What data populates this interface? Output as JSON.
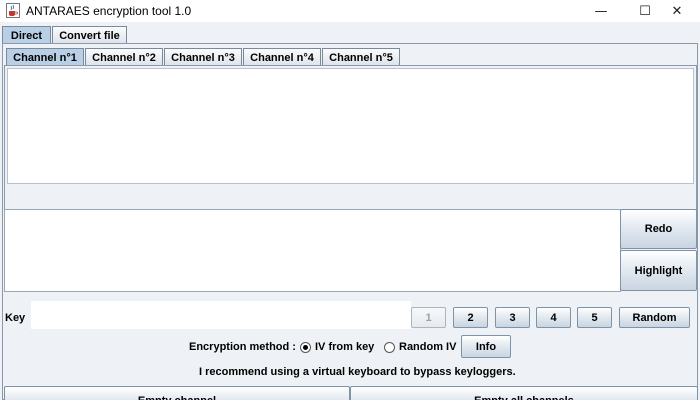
{
  "window": {
    "title": "ANTARAES encryption tool 1.0",
    "app_icon": "java-cup-icon",
    "controls": {
      "minimize": "—",
      "maximize": "☐",
      "close": "✕"
    }
  },
  "main_tabs": [
    {
      "label": "Direct",
      "active": true
    },
    {
      "label": "Convert file",
      "active": false
    }
  ],
  "channel_tabs": [
    {
      "label": "Channel n°1",
      "active": true
    },
    {
      "label": "Channel n°2",
      "active": false
    },
    {
      "label": "Channel n°3",
      "active": false
    },
    {
      "label": "Channel n°4",
      "active": false
    },
    {
      "label": "Channel n°5",
      "active": false
    }
  ],
  "output_text": "",
  "input_text": "",
  "side_buttons": {
    "redo": "Redo",
    "highlight": "Highlight"
  },
  "key": {
    "label": "Key",
    "value": "",
    "number_buttons": [
      "1",
      "2",
      "3",
      "4",
      "5"
    ],
    "selected_number": "1",
    "random": "Random"
  },
  "encryption": {
    "label": "Encryption method :",
    "options": [
      {
        "label": "IV from key",
        "checked": true
      },
      {
        "label": "Random IV",
        "checked": false
      }
    ],
    "info": "Info"
  },
  "note": "I recommend using a virtual keyboard to bypass keyloggers.",
  "bottom_buttons": {
    "empty_channel": "Empty channel",
    "empty_all": "Empty all channels"
  },
  "colors": {
    "background": "#eef2f6",
    "active_tab": "#b9cfe5",
    "border": "#7f93a8"
  }
}
